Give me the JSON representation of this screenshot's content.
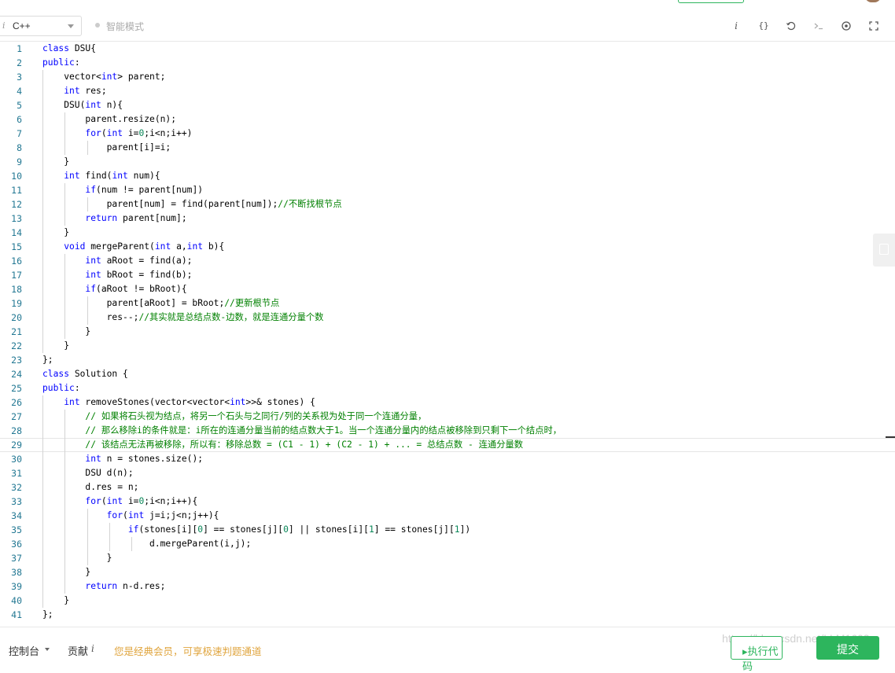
{
  "toolbar": {
    "lang_info": "i",
    "language": "C++",
    "smart_mode": "智能模式",
    "icons": [
      "info-icon",
      "braces-icon",
      "reset-icon",
      "terminal-icon",
      "settings-icon",
      "fullscreen-icon"
    ],
    "info_glyph": "i",
    "braces_glyph": "{}"
  },
  "editor": {
    "lines": [
      [
        {
          "t": "class",
          "c": "kw"
        },
        {
          "t": " DSU{",
          "c": ""
        }
      ],
      [
        {
          "t": "public",
          "c": "kw"
        },
        {
          "t": ":",
          "c": ""
        }
      ],
      [
        {
          "t": "    vector<",
          "c": ""
        },
        {
          "t": "int",
          "c": "kw"
        },
        {
          "t": "> parent;",
          "c": ""
        }
      ],
      [
        {
          "t": "    ",
          "c": ""
        },
        {
          "t": "int",
          "c": "kw"
        },
        {
          "t": " res;",
          "c": ""
        }
      ],
      [
        {
          "t": "    DSU(",
          "c": ""
        },
        {
          "t": "int",
          "c": "kw"
        },
        {
          "t": " n){",
          "c": ""
        }
      ],
      [
        {
          "t": "        parent.resize(n);",
          "c": ""
        }
      ],
      [
        {
          "t": "        ",
          "c": ""
        },
        {
          "t": "for",
          "c": "kw"
        },
        {
          "t": "(",
          "c": ""
        },
        {
          "t": "int",
          "c": "kw"
        },
        {
          "t": " i=",
          "c": ""
        },
        {
          "t": "0",
          "c": "num"
        },
        {
          "t": ";i<n;i++)",
          "c": ""
        }
      ],
      [
        {
          "t": "            parent[i]=i;",
          "c": ""
        }
      ],
      [
        {
          "t": "    }",
          "c": ""
        }
      ],
      [
        {
          "t": "    ",
          "c": ""
        },
        {
          "t": "int",
          "c": "kw"
        },
        {
          "t": " find(",
          "c": ""
        },
        {
          "t": "int",
          "c": "kw"
        },
        {
          "t": " num){",
          "c": ""
        }
      ],
      [
        {
          "t": "        ",
          "c": ""
        },
        {
          "t": "if",
          "c": "kw"
        },
        {
          "t": "(num != parent[num])",
          "c": ""
        }
      ],
      [
        {
          "t": "            parent[num] = find(parent[num]);",
          "c": ""
        },
        {
          "t": "//不断找根节点",
          "c": "cm"
        }
      ],
      [
        {
          "t": "        ",
          "c": ""
        },
        {
          "t": "return",
          "c": "kw"
        },
        {
          "t": " parent[num];",
          "c": ""
        }
      ],
      [
        {
          "t": "    }",
          "c": ""
        }
      ],
      [
        {
          "t": "    ",
          "c": ""
        },
        {
          "t": "void",
          "c": "kw"
        },
        {
          "t": " mergeParent(",
          "c": ""
        },
        {
          "t": "int",
          "c": "kw"
        },
        {
          "t": " a,",
          "c": ""
        },
        {
          "t": "int",
          "c": "kw"
        },
        {
          "t": " b){",
          "c": ""
        }
      ],
      [
        {
          "t": "        ",
          "c": ""
        },
        {
          "t": "int",
          "c": "kw"
        },
        {
          "t": " aRoot = find(a);",
          "c": ""
        }
      ],
      [
        {
          "t": "        ",
          "c": ""
        },
        {
          "t": "int",
          "c": "kw"
        },
        {
          "t": " bRoot = find(b);",
          "c": ""
        }
      ],
      [
        {
          "t": "        ",
          "c": ""
        },
        {
          "t": "if",
          "c": "kw"
        },
        {
          "t": "(aRoot != bRoot){",
          "c": ""
        }
      ],
      [
        {
          "t": "            parent[aRoot] = bRoot;",
          "c": ""
        },
        {
          "t": "//更新根节点",
          "c": "cm"
        }
      ],
      [
        {
          "t": "            res--;",
          "c": ""
        },
        {
          "t": "//其实就是总结点数-边数，就是连通分量个数",
          "c": "cm"
        }
      ],
      [
        {
          "t": "        }",
          "c": ""
        }
      ],
      [
        {
          "t": "    }",
          "c": ""
        }
      ],
      [
        {
          "t": "};",
          "c": ""
        }
      ],
      [
        {
          "t": "class",
          "c": "kw"
        },
        {
          "t": " Solution {",
          "c": ""
        }
      ],
      [
        {
          "t": "public",
          "c": "kw"
        },
        {
          "t": ":",
          "c": ""
        }
      ],
      [
        {
          "t": "    ",
          "c": ""
        },
        {
          "t": "int",
          "c": "kw"
        },
        {
          "t": " removeStones(vector<vector<",
          "c": ""
        },
        {
          "t": "int",
          "c": "kw"
        },
        {
          "t": ">>& stones) {",
          "c": ""
        }
      ],
      [
        {
          "t": "        ",
          "c": ""
        },
        {
          "t": "// 如果将石头视为结点，将另一个石头与之同行/列的关系视为处于同一个连通分量，",
          "c": "cm"
        }
      ],
      [
        {
          "t": "        ",
          "c": ""
        },
        {
          "t": "// 那么移除i的条件就是：i所在的连通分量当前的结点数大于1。当一个连通分量内的结点被移除到只剩下一个结点时，",
          "c": "cm"
        }
      ],
      [
        {
          "t": "        ",
          "c": ""
        },
        {
          "t": "// 该结点无法再被移除，所以有：移除总数 = (C1 - 1) + (C2 - 1) + ... = 总结点数 - 连通分量数",
          "c": "cm"
        }
      ],
      [
        {
          "t": "        ",
          "c": ""
        },
        {
          "t": "int",
          "c": "kw"
        },
        {
          "t": " n = stones.size();",
          "c": ""
        }
      ],
      [
        {
          "t": "        DSU d(n);",
          "c": ""
        }
      ],
      [
        {
          "t": "        d.res = n;",
          "c": ""
        }
      ],
      [
        {
          "t": "        ",
          "c": ""
        },
        {
          "t": "for",
          "c": "kw"
        },
        {
          "t": "(",
          "c": ""
        },
        {
          "t": "int",
          "c": "kw"
        },
        {
          "t": " i=",
          "c": ""
        },
        {
          "t": "0",
          "c": "num"
        },
        {
          "t": ";i<n;i++){",
          "c": ""
        }
      ],
      [
        {
          "t": "            ",
          "c": ""
        },
        {
          "t": "for",
          "c": "kw"
        },
        {
          "t": "(",
          "c": ""
        },
        {
          "t": "int",
          "c": "kw"
        },
        {
          "t": " j=i;j<n;j++){",
          "c": ""
        }
      ],
      [
        {
          "t": "                ",
          "c": ""
        },
        {
          "t": "if",
          "c": "kw"
        },
        {
          "t": "(stones[i][",
          "c": ""
        },
        {
          "t": "0",
          "c": "num"
        },
        {
          "t": "] == stones[j][",
          "c": ""
        },
        {
          "t": "0",
          "c": "num"
        },
        {
          "t": "] || stones[i][",
          "c": ""
        },
        {
          "t": "1",
          "c": "num"
        },
        {
          "t": "] == stones[j][",
          "c": ""
        },
        {
          "t": "1",
          "c": "num"
        },
        {
          "t": "])",
          "c": ""
        }
      ],
      [
        {
          "t": "                    d.mergeParent(i,j);",
          "c": ""
        }
      ],
      [
        {
          "t": "            }",
          "c": ""
        }
      ],
      [
        {
          "t": "        }",
          "c": ""
        }
      ],
      [
        {
          "t": "        ",
          "c": ""
        },
        {
          "t": "return",
          "c": "kw"
        },
        {
          "t": " n-d.res;",
          "c": ""
        }
      ],
      [
        {
          "t": "    }",
          "c": ""
        }
      ],
      [
        {
          "t": "};",
          "c": ""
        }
      ]
    ],
    "current_line": 29,
    "syntax_colors": {
      "kw": "#0000ff",
      "num": "#098658",
      "cm": "#008000",
      "text": "#000000",
      "gutter": "#237893"
    }
  },
  "bottom": {
    "console": "控制台",
    "contribute": "贡献",
    "contribute_info": "i",
    "vip_notice": "您是经典会员，可享极速判题通道",
    "watermark": "https://blog.csdn.net/LLM1602",
    "run_button": "▸执行代码",
    "submit_button": "提交"
  },
  "colors": {
    "accent_green": "#2db55d",
    "vip_orange": "#e0a53f"
  }
}
